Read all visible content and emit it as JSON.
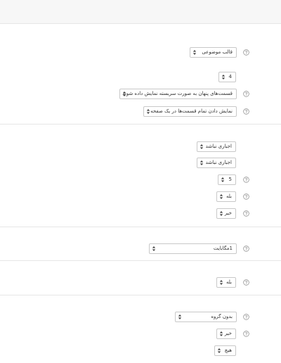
{
  "section1": {
    "template_select": {
      "value": "قالب موضوعی"
    },
    "count_select": {
      "value": "4"
    },
    "hidden_sections_select": {
      "value": "قسمت‌های پنهان به صورت سربسته نمایش داده شوند"
    },
    "layout_select": {
      "value": "نمایش دادن تمام قسمت‌ها در یک صفحه"
    }
  },
  "section2": {
    "select_a": {
      "value": "اجباری نباشد"
    },
    "select_b": {
      "value": "اجباری نباشد"
    },
    "number_select": {
      "value": "5"
    },
    "yes_select": {
      "value": "بله"
    },
    "no_select": {
      "value": "خیر"
    }
  },
  "section3": {
    "size_select": {
      "value": "1مگابایت"
    }
  },
  "section4": {
    "yes_select": {
      "value": "بله"
    }
  },
  "section5": {
    "group_select": {
      "value": "بدون گروه"
    },
    "no_select": {
      "value": "خیر"
    },
    "none_select": {
      "value": "هیچ"
    }
  },
  "icons": {
    "help": "question-circle-icon",
    "caret": "sort-arrows-icon"
  },
  "colors": {
    "border": "#c8c8c8",
    "divider": "#e6e6e6",
    "top_band": "#f7f7f7",
    "help_icon": "#8a8a8a"
  }
}
